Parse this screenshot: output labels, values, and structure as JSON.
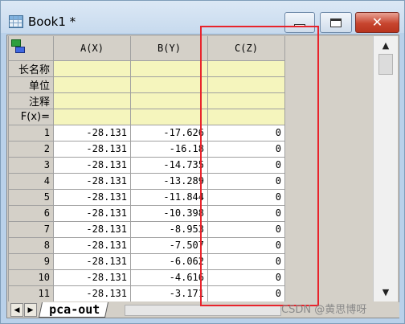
{
  "window": {
    "title": "Book1 *",
    "icons": {
      "app": "spreadsheet-icon",
      "minimize": "minimize-icon",
      "maximize": "maximize-icon",
      "close": "close-icon"
    },
    "close_glyph": "✕"
  },
  "sheet": {
    "corner_icon": "worksheet-icon",
    "columns": [
      "A(X)",
      "B(Y)",
      "C(Z)"
    ],
    "meta_rows": [
      {
        "label": "长名称"
      },
      {
        "label": "单位"
      },
      {
        "label": "注释"
      },
      {
        "label": "F(x)="
      }
    ],
    "rows": [
      {
        "num": "1",
        "a": "-28.131",
        "b": "-17.626",
        "c": "0"
      },
      {
        "num": "2",
        "a": "-28.131",
        "b": "-16.18",
        "c": "0"
      },
      {
        "num": "3",
        "a": "-28.131",
        "b": "-14.735",
        "c": "0"
      },
      {
        "num": "4",
        "a": "-28.131",
        "b": "-13.289",
        "c": "0"
      },
      {
        "num": "5",
        "a": "-28.131",
        "b": "-11.844",
        "c": "0"
      },
      {
        "num": "6",
        "a": "-28.131",
        "b": "-10.398",
        "c": "0"
      },
      {
        "num": "7",
        "a": "-28.131",
        "b": "-8.953",
        "c": "0"
      },
      {
        "num": "8",
        "a": "-28.131",
        "b": "-7.507",
        "c": "0"
      },
      {
        "num": "9",
        "a": "-28.131",
        "b": "-6.062",
        "c": "0"
      },
      {
        "num": "10",
        "a": "-28.131",
        "b": "-4.616",
        "c": "0"
      },
      {
        "num": "11",
        "a": "-28.131",
        "b": "-3.171",
        "c": "0"
      }
    ]
  },
  "scrollbar": {
    "up_glyph": "▲",
    "down_glyph": "▼"
  },
  "tabs": {
    "prev_glyph": "◀",
    "next_glyph": "▶",
    "active": "pca-out"
  },
  "annotation": {
    "color": "#e8242c"
  },
  "watermark": "CSDN @黄思博呀"
}
